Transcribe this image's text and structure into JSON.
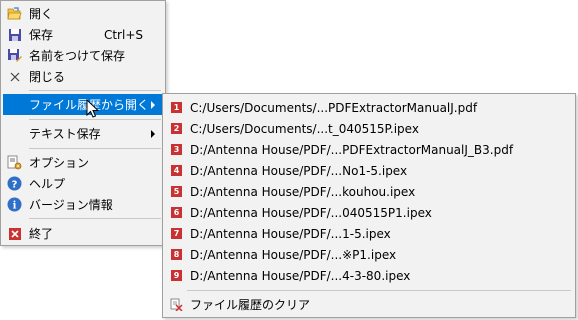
{
  "main_menu": {
    "items": [
      {
        "label": "開く",
        "icon": "folder-open-icon"
      },
      {
        "label": "保存",
        "shortcut": "Ctrl+S",
        "icon": "save-icon"
      },
      {
        "label": "名前をつけて保存",
        "icon": "save-as-icon"
      },
      {
        "label": "閉じる",
        "icon": "close-icon"
      },
      {
        "label": "ファイル履歴から開く",
        "icon": "",
        "has_submenu": true,
        "highlighted": true
      },
      {
        "label": "テキスト保存",
        "icon": "",
        "has_submenu": true
      },
      {
        "label": "オプション",
        "icon": "options-icon"
      },
      {
        "label": "ヘルプ",
        "icon": "help-icon"
      },
      {
        "label": "バージョン情報",
        "icon": "info-icon"
      },
      {
        "label": "終了",
        "icon": "exit-icon"
      }
    ]
  },
  "history_submenu": {
    "items": [
      {
        "num": "1",
        "label": "C:/Users/Documents/...PDFExtractorManualJ.pdf"
      },
      {
        "num": "2",
        "label": "C:/Users/Documents/...t_040515P.ipex"
      },
      {
        "num": "3",
        "label": "D:/Antenna House/PDF/...PDFExtractorManualJ_B3.pdf"
      },
      {
        "num": "4",
        "label": "D:/Antenna House/PDF/...No1-5.ipex"
      },
      {
        "num": "5",
        "label": "D:/Antenna House/PDF/...kouhou.ipex"
      },
      {
        "num": "6",
        "label": "D:/Antenna House/PDF/...040515P1.ipex"
      },
      {
        "num": "7",
        "label": "D:/Antenna House/PDF/...1-5.ipex"
      },
      {
        "num": "8",
        "label": "D:/Antenna House/PDF/...※P1.ipex"
      },
      {
        "num": "9",
        "label": "D:/Antenna House/PDF/...4-3-80.ipex"
      }
    ],
    "clear_label": "ファイル履歴のクリア"
  },
  "colors": {
    "highlight": "#0078d7",
    "badge": "#c83232",
    "menu_bg": "#f2f2f2"
  }
}
